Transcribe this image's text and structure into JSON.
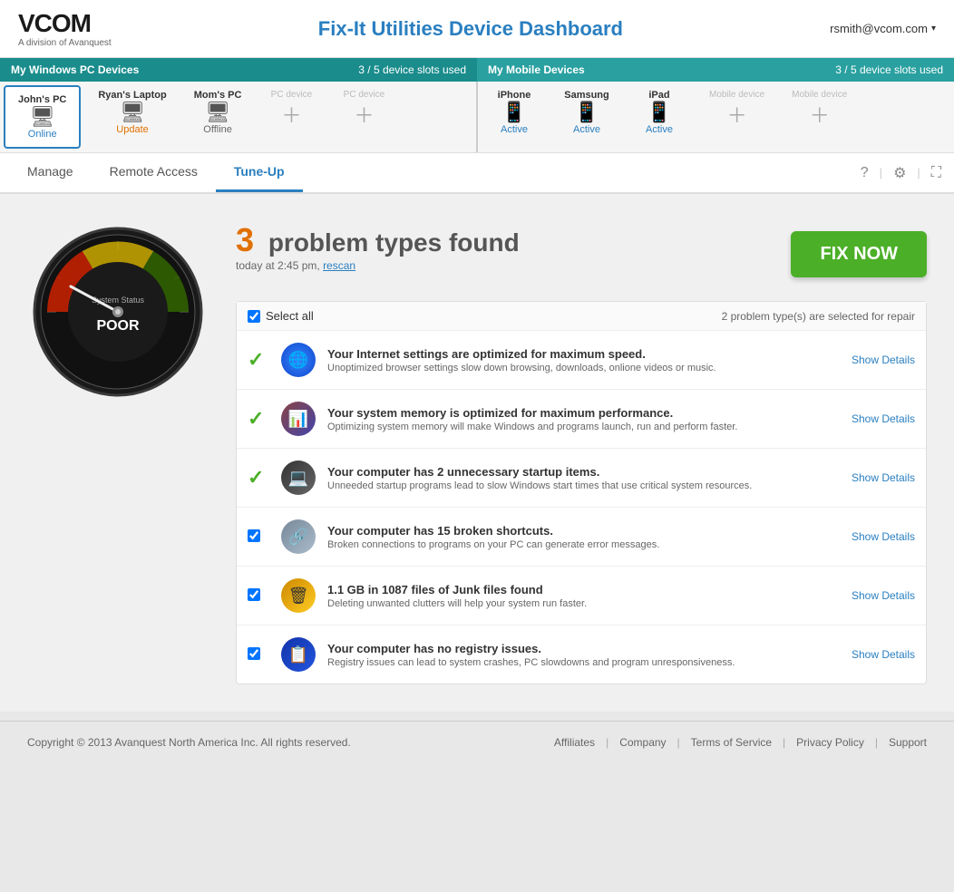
{
  "header": {
    "logo": "VCOM",
    "logo_sub": "A division of Avanquest",
    "title": "Fix-It Utilities Device Dashboard",
    "user": "rsmith@vcom.com"
  },
  "device_bars": {
    "pc": {
      "label": "My Windows PC Devices",
      "slots": "3 / 5 device slots used"
    },
    "mobile": {
      "label": "My Mobile Devices",
      "slots": "3 / 5 device slots used"
    }
  },
  "pc_devices": [
    {
      "name": "John's PC",
      "status": "Online",
      "status_class": "online",
      "icon": "💻"
    },
    {
      "name": "Ryan's Laptop",
      "status": "Update",
      "status_class": "update",
      "icon": "💻"
    },
    {
      "name": "Mom's PC",
      "status": "Offline",
      "status_class": "offline",
      "icon": "💻"
    },
    {
      "name": "PC device",
      "status": "+",
      "status_class": "add",
      "icon": "+"
    },
    {
      "name": "PC device",
      "status": "+",
      "status_class": "add",
      "icon": "+"
    }
  ],
  "mobile_devices": [
    {
      "name": "iPhone",
      "status": "Active",
      "status_class": "active",
      "icon": "📱"
    },
    {
      "name": "Samsung",
      "status": "Active",
      "status_class": "active",
      "icon": "📱"
    },
    {
      "name": "iPad",
      "status": "Active",
      "status_class": "active",
      "icon": "📱"
    },
    {
      "name": "Mobile device",
      "status": "+",
      "status_class": "add",
      "icon": "+"
    },
    {
      "name": "Mobile device",
      "status": "+",
      "status_class": "add",
      "icon": "+"
    }
  ],
  "nav_tabs": [
    {
      "label": "Manage",
      "active": false
    },
    {
      "label": "Remote Access",
      "active": false
    },
    {
      "label": "Tune-Up",
      "active": true
    }
  ],
  "tune_up": {
    "gauge_label": "System Status",
    "gauge_value": "POOR",
    "problem_count": "3",
    "problem_text": "problem types found",
    "scan_time": "today at 2:45 pm,",
    "rescan": "rescan",
    "fix_now": "FIX NOW",
    "select_all": "Select all",
    "selected_count": "2 problem type(s) are selected for repair",
    "problems": [
      {
        "checked": true,
        "green_check": true,
        "icon_type": "internet",
        "title": "Your Internet settings are optimized for maximum speed.",
        "desc": "Unoptimized browser settings slow down browsing, downloads, onlione videos or music.",
        "show_details": "Show Details"
      },
      {
        "checked": true,
        "green_check": true,
        "icon_type": "memory",
        "title": "Your system memory is optimized for maximum performance.",
        "desc": "Optimizing system memory will make Windows and programs launch, run and perform faster.",
        "show_details": "Show Details"
      },
      {
        "checked": true,
        "green_check": true,
        "icon_type": "startup",
        "title": "Your computer has 2 unnecessary startup items.",
        "desc": "Unneeded startup programs lead to slow Windows start times that use critical system resources.",
        "show_details": "Show Details"
      },
      {
        "checked": true,
        "green_check": false,
        "icon_type": "shortcuts",
        "title": "Your computer has 15 broken shortcuts.",
        "desc": "Broken connections to programs on your PC can generate error messages.",
        "show_details": "Show Details"
      },
      {
        "checked": true,
        "green_check": false,
        "icon_type": "junk",
        "title": "1.1 GB in 1087 files of Junk files found",
        "desc": "Deleting unwanted clutters will help your system run faster.",
        "show_details": "Show Details"
      },
      {
        "checked": true,
        "green_check": false,
        "icon_type": "registry",
        "title": "Your computer has no registry issues.",
        "desc": "Registry issues can lead to system crashes, PC slowdowns and program unresponsiveness.",
        "show_details": "Show Details"
      }
    ]
  },
  "footer": {
    "copyright": "Copyright © 2013 Avanquest North America Inc. All rights reserved.",
    "links": [
      "Affiliates",
      "Company",
      "Terms of Service",
      "Privacy Policy",
      "Support"
    ]
  }
}
